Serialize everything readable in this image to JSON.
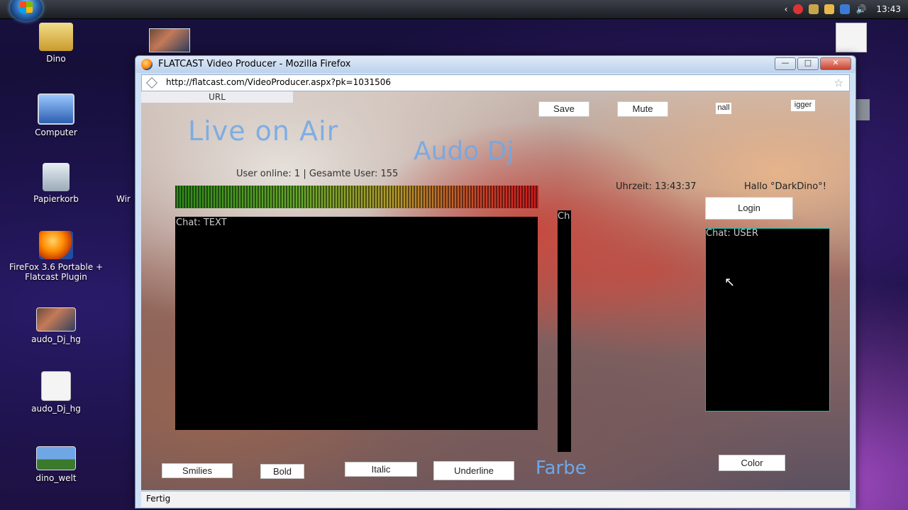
{
  "taskbar": {
    "clock": "13:43"
  },
  "desktop": {
    "icons": [
      {
        "label": "Dino"
      },
      {
        "label": "Computer"
      },
      {
        "label": "Papierkorb"
      },
      {
        "label": "FireFox 3.6 Portable + Flatcast Plugin"
      },
      {
        "label": "audo_Dj_hg"
      },
      {
        "label": "audo_Dj_hg"
      },
      {
        "label": "dino_welt"
      }
    ],
    "partial_label": "Wir"
  },
  "window": {
    "title": "FLATCAST Video Producer - Mozilla Firefox",
    "url": "http://flatcast.com/VideoProducer.aspx?pk=1031506",
    "status": "Fertig"
  },
  "page": {
    "url_tab": "URL",
    "buttons": {
      "save": "Save",
      "mute": "Mute",
      "small": "nall",
      "bigger": "igger",
      "login": "Login",
      "smilies": "Smilies",
      "bold": "Bold",
      "italic": "Italic",
      "underline": "Underline",
      "color": "Color"
    },
    "live_text": "Live on Air",
    "dj_name": "Audo Dj",
    "stats": "User online: 1 | Gesamte User: 155",
    "time": "Uhrzeit: 13:43:37",
    "hello": "Hallo °DarkDino°!",
    "chat_text_label": "Chat: TEXT",
    "chat_user_label": "Chat: USER",
    "chat_mid_label": "Ch",
    "farbe": "Farbe"
  }
}
